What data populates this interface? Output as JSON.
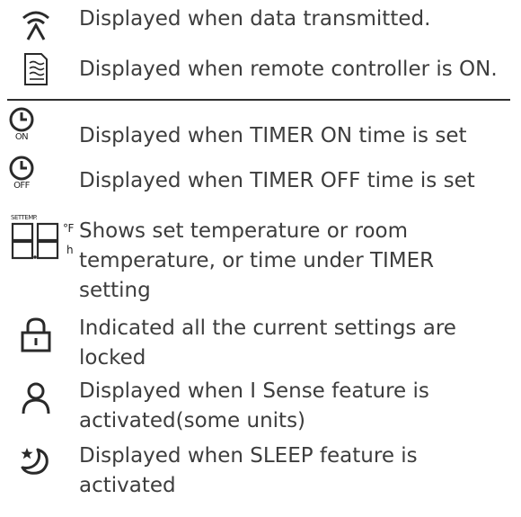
{
  "rows": [
    {
      "icon": "transmit-icon",
      "lines": [
        "Displayed when data transmitted."
      ]
    },
    {
      "icon": "remote-on-icon",
      "lines": [
        "Displayed when remote controller is ON."
      ]
    },
    {
      "icon": "timer-on-icon",
      "icon_label": "ON",
      "lines": [
        "Displayed when TIMER ON time is set"
      ]
    },
    {
      "icon": "timer-off-icon",
      "icon_label": "OFF",
      "lines": [
        "Displayed when TIMER OFF time is set"
      ]
    },
    {
      "icon": "temperature-display-icon",
      "icon_label_top": "SETTEMP.",
      "icon_label_f": "°F",
      "icon_label_h": "h",
      "lines": [
        "Shows set temperature or room",
        "temperature, or time under TIMER",
        "setting"
      ]
    },
    {
      "icon": "lock-icon",
      "lines": [
        "Indicated all the current settings are",
        "locked"
      ]
    },
    {
      "icon": "person-icon",
      "lines": [
        "Displayed when I Sense feature is",
        "activated(some units)"
      ]
    },
    {
      "icon": "sleep-icon",
      "lines": [
        "Displayed when SLEEP feature is",
        "activated"
      ]
    }
  ]
}
